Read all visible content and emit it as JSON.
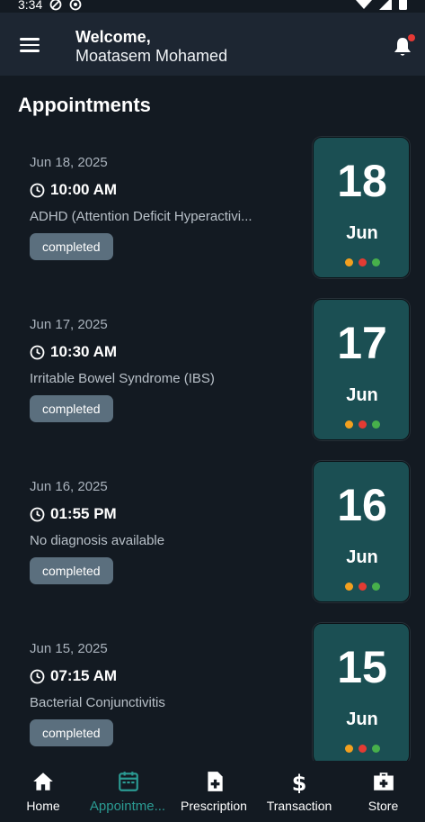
{
  "status_bar": {
    "time": "3:34"
  },
  "header": {
    "welcome": "Welcome,",
    "user_name": "Moatasem Mohamed"
  },
  "section_title": "Appointments",
  "appointments": [
    {
      "date": "Jun 18, 2025",
      "time": "10:00 AM",
      "diagnosis": "ADHD (Attention Deficit Hyperactivi...",
      "status": "completed",
      "day": "18",
      "month": "Jun"
    },
    {
      "date": "Jun 17, 2025",
      "time": "10:30 AM",
      "diagnosis": "Irritable Bowel Syndrome (IBS)",
      "status": "completed",
      "day": "17",
      "month": "Jun"
    },
    {
      "date": "Jun 16, 2025",
      "time": "01:55 PM",
      "diagnosis": "No diagnosis available",
      "status": "completed",
      "day": "16",
      "month": "Jun"
    },
    {
      "date": "Jun 15, 2025",
      "time": "07:15 AM",
      "diagnosis": "Bacterial Conjunctivitis",
      "status": "completed",
      "day": "15",
      "month": "Jun"
    }
  ],
  "dot_colors": [
    "#f2a01f",
    "#e33b33",
    "#47b04b"
  ],
  "colors": {
    "accent": "#2b9b93",
    "date_box": "#1b4f53",
    "badge": "#5b6f7e",
    "background": "#131a22"
  },
  "bottom_nav": [
    {
      "label": "Home",
      "icon": "home-icon",
      "active": false
    },
    {
      "label": "Appointme...",
      "icon": "calendar-icon",
      "active": true
    },
    {
      "label": "Prescription",
      "icon": "prescription-icon",
      "active": false
    },
    {
      "label": "Transaction",
      "icon": "dollar-icon",
      "active": false
    },
    {
      "label": "Store",
      "icon": "store-icon",
      "active": false
    }
  ]
}
